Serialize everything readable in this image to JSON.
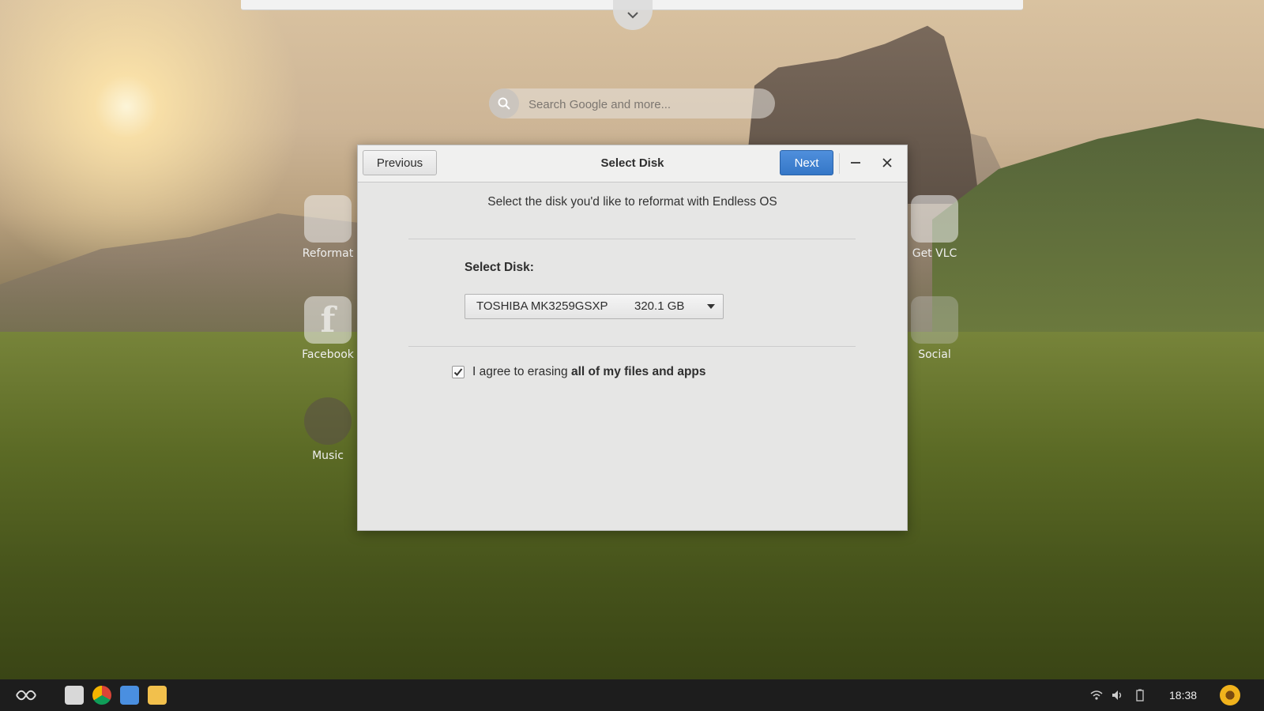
{
  "desktop": {
    "search": {
      "placeholder": "Search Google and more..."
    },
    "apps_left": [
      {
        "label": "Reformat",
        "icon": "download-drive-icon"
      },
      {
        "label": "Facebook",
        "icon": "facebook-icon"
      },
      {
        "label": "Music",
        "icon": "music-disc-icon"
      }
    ],
    "apps_right": [
      {
        "label": "Get VLC",
        "icon": "vlc-cone-icon"
      },
      {
        "label": "Social",
        "icon": "social-folder-icon"
      }
    ]
  },
  "dialog": {
    "title": "Select Disk",
    "previous_label": "Previous",
    "next_label": "Next",
    "intro": "Select the disk you'd like to reformat with Endless OS",
    "select_disk_label": "Select Disk:",
    "disk": {
      "name": "TOSHIBA MK3259GSXP",
      "size": "320.1 GB"
    },
    "agree_prefix": "I agree to erasing ",
    "agree_bold": "all of my files and apps",
    "agree_checked": true
  },
  "taskbar": {
    "clock": "18:38",
    "apps": [
      "installer-icon",
      "chrome-icon",
      "browser-icon",
      "files-icon"
    ],
    "tray": [
      "wifi-icon",
      "volume-icon",
      "battery-icon"
    ]
  },
  "colors": {
    "accent": "#3577c7",
    "taskbar": "#1d1d1d",
    "dialog_bg": "#e6e6e5"
  }
}
